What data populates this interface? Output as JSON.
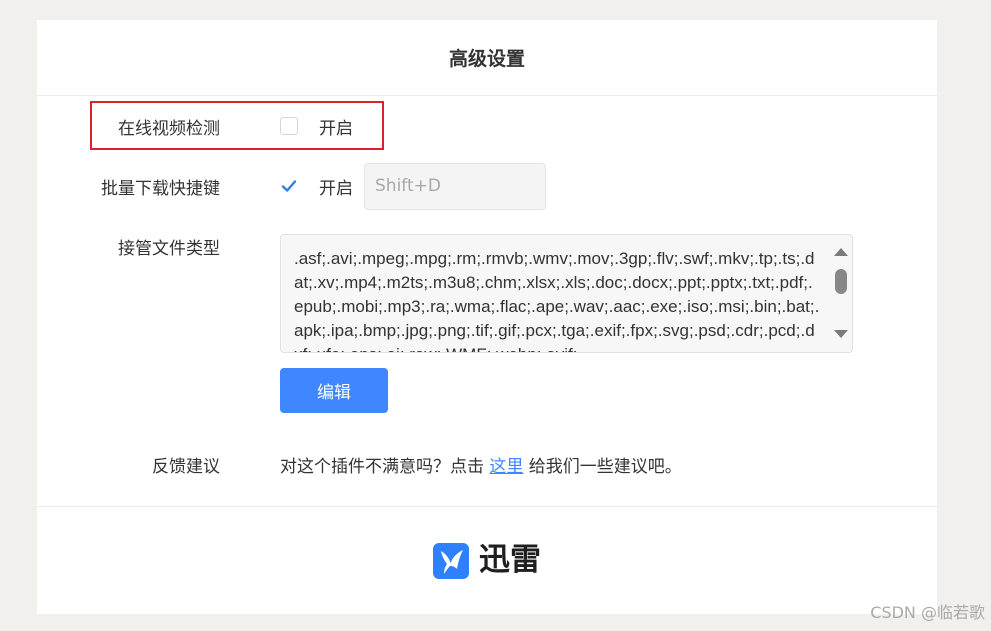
{
  "settings": {
    "title": "高级设置",
    "online_video": {
      "label": "在线视频检测",
      "option": "开启",
      "checked": false
    },
    "batch_download": {
      "label": "批量下载快捷键",
      "option": "开启",
      "checked": true,
      "shortcut": "Shift+D"
    },
    "file_types": {
      "label": "接管文件类型",
      "value": ".asf;.avi;.mpeg;.mpg;.rm;.rmvb;.wmv;.mov;.3gp;.flv;.swf;.mkv;.tp;.ts;.dat;.xv;.mp4;.m2ts;.m3u8;.chm;.xlsx;.xls;.doc;.docx;.ppt;.pptx;.txt;.pdf;.epub;.mobi;.mp3;.ra;.wma;.flac;.ape;.wav;.aac;.exe;.iso;.msi;.bin;.bat;.apk;.ipa;.bmp;.jpg;.png;.tif;.gif;.pcx;.tga;.exif;.fpx;.svg;.psd;.cdr;.pcd;.dxf;.ufo;.eps;.ai;.raw;.WMF;.webp;.avif;",
      "edit_label": "编辑"
    },
    "feedback": {
      "label": "反馈建议",
      "text_before": "对这个插件不满意吗？点击 ",
      "link": "这里",
      "text_after": " 给我们一些建议吧。"
    }
  },
  "brand": {
    "name": "迅雷",
    "logo_icon": "thunder-bird-logo-icon",
    "color": "#2f80ff"
  },
  "watermark": "CSDN @临若歌",
  "colors": {
    "accent": "#3f87ff",
    "highlight": "#d9232b"
  }
}
